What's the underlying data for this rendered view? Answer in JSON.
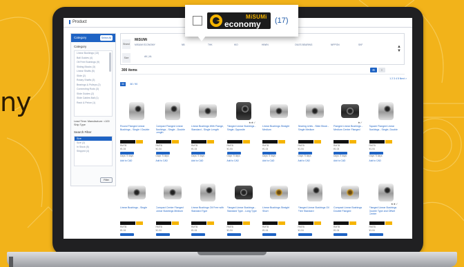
{
  "background": {
    "accent": "#f2b31a",
    "side_text": "ny"
  },
  "app": {
    "tab": "Product"
  },
  "sidebar": {
    "header_label": "Category",
    "header_button": "Select All",
    "category_title": "Category",
    "categories": [
      "Linear Bushings (13)",
      "Ball Guides (4)",
      "Oil Free Bushings (9)",
      "Sliding Blocks (3)",
      "Linear Shafts (5)",
      "Slide (2)",
      "Rotary Shafts (3)",
      "Bearings & Pulleys (2)",
      "Connecting Rods (3)",
      "Slide Guides (2)",
      "Slide Cables Ball (1)",
      "Rack & Pinion (1)"
    ],
    "lead_time": "Lead Time: Manufacture: <100 Ship Type",
    "search_title": "Search Filter",
    "search_selected": "Size",
    "search_items": [
      "Size (2)",
      "In Stock (5)",
      "Shipped (4)"
    ],
    "filter_button": "Filter"
  },
  "filter_panel": {
    "brand_row_label": "Brand",
    "brand_logo": "MiSUMi",
    "brand_options": [
      "MISUMI ECONOMY",
      "NB",
      "THK",
      "IKO",
      "HIWIN",
      "OILES BEARING",
      "NIPPON",
      "SKF"
    ],
    "size_row_label": "Size",
    "size_options": "All  |  UL"
  },
  "results": {
    "count_text": "300 items",
    "per_page_active": "30",
    "per_page_other": "60 / 90",
    "view_grid": "⊞",
    "view_list": "≡",
    "pagination": "1  2  3  4  5  Next >"
  },
  "products_row1": [
    {
      "name": "Round Flanged Linear Bushings - Single / Double",
      "meta1": "RMTB",
      "meta2": "¥1.04",
      "meta3": "Days: 5 days",
      "cad": "Add to CAD",
      "rating": "",
      "type": "flange",
      "tone": "light"
    },
    {
      "name": "Compact Flanged Linear Bushings - Single - Double Length",
      "meta1": "RMTB",
      "meta2": "¥1.04",
      "meta3": "Days: 5 days",
      "cad": "Add to CAD",
      "rating": "",
      "type": "flange",
      "tone": "light"
    },
    {
      "name": "Linear Bushings With Flange, Standard - Single Length",
      "meta1": "RMTB",
      "meta2": "¥1.04",
      "meta3": "Days: 5 days",
      "cad": "Add to CAD",
      "rating": "",
      "type": "round",
      "tone": "light"
    },
    {
      "name": "Flanged Linear Bushings - Single, Opposite",
      "meta1": "RMTB",
      "meta2": "¥1.04",
      "meta3": "Days: 5 days",
      "cad": "Add to CAD",
      "rating": "★★✓",
      "type": "flange",
      "tone": "dark"
    },
    {
      "name": "Linear Bushings Straight Medium",
      "meta1": "RMTB",
      "meta2": "¥1.04",
      "meta3": "Days: 5 days",
      "cad": "Add to CAD",
      "rating": "",
      "type": "round",
      "tone": "light"
    },
    {
      "name": "Bearing Units - Slide Block - Single Medium",
      "meta1": "RMTB",
      "meta2": "¥1.04",
      "meta3": "Days: 5 days",
      "cad": "Add to CAD",
      "rating": "",
      "type": "block",
      "tone": "light"
    },
    {
      "name": "Flanged Linear Bushings - Medium Center Flanged",
      "meta1": "RMTB",
      "meta2": "¥1.04",
      "meta3": "Days: 5 days",
      "cad": "Add to CAD",
      "rating": "★✓",
      "type": "round",
      "tone": "dark"
    },
    {
      "name": "Square Flanged Linear Bushings - Single, Double",
      "meta1": "RMTB",
      "meta2": "¥1.04",
      "meta3": "Days: 5 days",
      "cad": "Add to CAD",
      "rating": "",
      "type": "flange",
      "tone": "light"
    }
  ],
  "products_row2": [
    {
      "name": "Linear Bushings - Single",
      "meta1": "RMTB",
      "meta2": "¥1.04",
      "type": "round",
      "tone": "light",
      "rating": ""
    },
    {
      "name": "Compact Center Flanged Linear Bushings Medium",
      "meta1": "RMTB",
      "meta2": "¥1.04",
      "type": "round",
      "tone": "light",
      "rating": ""
    },
    {
      "name": "Linear Bushings Oil Free with Standard Type",
      "meta1": "RMTB",
      "meta2": "¥1.04",
      "type": "flange",
      "tone": "light",
      "rating": ""
    },
    {
      "name": "Flanged Linear Bushings - Standard Type - Long Type",
      "meta1": "RMTB",
      "meta2": "¥1.04",
      "type": "round",
      "tone": "dark",
      "rating": ""
    },
    {
      "name": "Linear Bushings Straight Short",
      "meta1": "RMTB",
      "meta2": "¥1.04",
      "type": "round",
      "tone": "brass",
      "rating": ""
    },
    {
      "name": "Flanged Linear Bushings Oil Free Standard",
      "meta1": "RMTB",
      "meta2": "¥1.04",
      "type": "flange",
      "tone": "light",
      "rating": ""
    },
    {
      "name": "Compact Linear Bushings Double Flanged",
      "meta1": "RMTB",
      "meta2": "¥1.04",
      "type": "round",
      "tone": "brass",
      "rating": ""
    },
    {
      "name": "Flanged Linear Bushings Double Type and Offset Center",
      "meta1": "RMTB",
      "meta2": "¥1.04",
      "type": "flange",
      "tone": "light",
      "rating": "★★✓"
    }
  ],
  "callout": {
    "brand": "MiSUMi",
    "label": "economy",
    "count": "(17)"
  }
}
